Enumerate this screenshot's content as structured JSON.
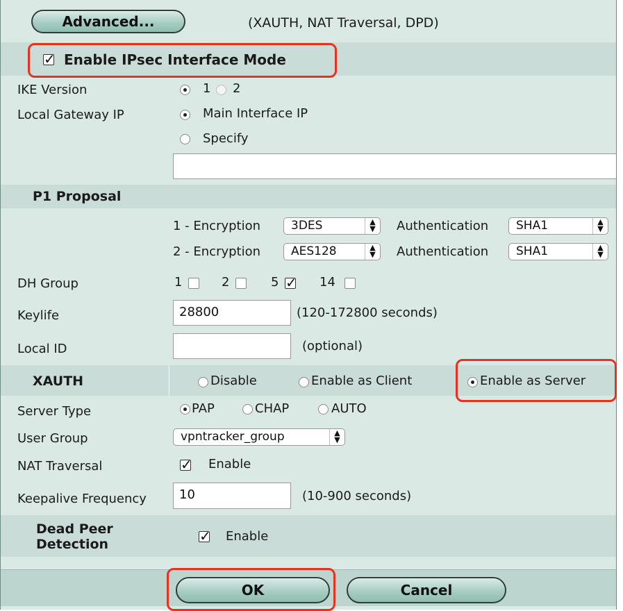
{
  "top": {
    "advanced_button": "Advanced...",
    "advanced_note": "(XAUTH, NAT Traversal, DPD)"
  },
  "interface_mode": {
    "label": "Enable IPsec Interface Mode",
    "checked": true
  },
  "ike_version": {
    "label": "IKE Version",
    "options": [
      "1",
      "2"
    ],
    "selected": "1"
  },
  "local_gateway": {
    "label": "Local Gateway IP",
    "options": [
      "Main Interface IP",
      "Specify"
    ],
    "selected": "Main Interface IP",
    "specify_value": ""
  },
  "p1_proposal": {
    "title": "P1 Proposal",
    "rows": [
      {
        "enc_label": "1 - Encryption",
        "enc_value": "3DES",
        "auth_label": "Authentication",
        "auth_value": "SHA1"
      },
      {
        "enc_label": "2 - Encryption",
        "enc_value": "AES128",
        "auth_label": "Authentication",
        "auth_value": "SHA1"
      }
    ]
  },
  "dh_group": {
    "label": "DH Group",
    "options": [
      {
        "name": "1",
        "checked": false
      },
      {
        "name": "2",
        "checked": false
      },
      {
        "name": "5",
        "checked": true
      },
      {
        "name": "14",
        "checked": false
      }
    ]
  },
  "keylife": {
    "label": "Keylife",
    "value": "28800",
    "hint": "(120-172800 seconds)"
  },
  "local_id": {
    "label": "Local ID",
    "value": "",
    "hint": "(optional)"
  },
  "xauth": {
    "label": "XAUTH",
    "options": [
      "Disable",
      "Enable as Client",
      "Enable as Server"
    ],
    "selected": "Enable as Server"
  },
  "server_type": {
    "label": "Server Type",
    "options": [
      "PAP",
      "CHAP",
      "AUTO"
    ],
    "selected": "PAP"
  },
  "user_group": {
    "label": "User Group",
    "value": "vpntracker_group"
  },
  "nat_traversal": {
    "label": "NAT Traversal",
    "enable_label": "Enable",
    "checked": true
  },
  "keepalive": {
    "label": "Keepalive Frequency",
    "value": "10",
    "hint": "(10-900 seconds)"
  },
  "dpd": {
    "label_line1": "Dead Peer",
    "label_line2": "Detection",
    "enable_label": "Enable",
    "checked": true
  },
  "footer": {
    "ok": "OK",
    "cancel": "Cancel"
  },
  "colors": {
    "panel": "#dbe9e5",
    "band": "#c9dcd7",
    "highlight": "#e8321f"
  },
  "icons": {
    "checkbox": "checkmark-icon",
    "select_arrow": "updown-arrows-icon"
  }
}
